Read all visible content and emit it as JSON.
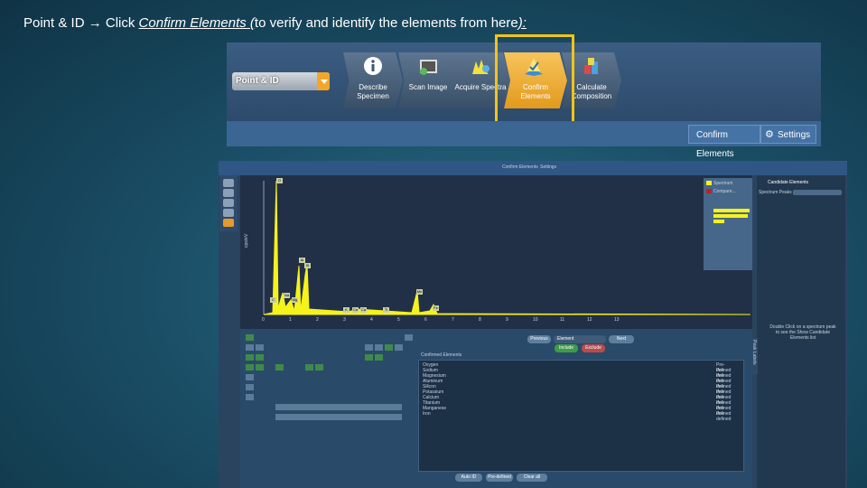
{
  "slide": {
    "title_prefix": "Point & ID ",
    "arrow": "→",
    "title_mid": " Click ",
    "title_link": "Confirm Elements (",
    "title_rest": "to verify and identify the elements from here",
    "title_end": "):"
  },
  "toolbar": {
    "dropdown": "Point & ID",
    "steps": [
      {
        "label": "Describe Specimen",
        "icon": "info-icon"
      },
      {
        "label": "Scan Image",
        "icon": "image-icon"
      },
      {
        "label": "Acquire Spectra",
        "icon": "spectrum-icon"
      },
      {
        "label": "Confirm Elements",
        "icon": "confirm-elements-icon"
      },
      {
        "label": "Calculate Composition",
        "icon": "composition-icon"
      }
    ],
    "ribbon_confirm": "Confirm Elements",
    "ribbon_settings": "Settings"
  },
  "app": {
    "header_confirm": "Confirm Elements",
    "header_settings": "Settings",
    "legend_series": [
      "Spectrum",
      "Compare..."
    ],
    "right_title": "Candidate Elements",
    "right_sub": "Spectrum Peaks",
    "right_hint": "Double Click on a spectrum peak to see the Show Candidate Elements list",
    "spectrum_labels": [
      "O",
      "Al",
      "Si",
      "C",
      "Mg",
      "Na",
      "K",
      "Ca",
      "Ca",
      "Ti",
      "Mn",
      "Fe"
    ],
    "x_ticks": [
      "0",
      "1",
      "2",
      "3",
      "4",
      "5",
      "6",
      "7",
      "8",
      "9",
      "10",
      "11",
      "12",
      "13"
    ],
    "nav": {
      "previous": "Previous",
      "next": "Next",
      "dropdown": "Element",
      "include": "Include",
      "exclude": "Exclude"
    },
    "list_title": "Confirmed Elements",
    "elements": [
      {
        "name": "Oxygen",
        "status": "Pre-defined"
      },
      {
        "name": "Sodium",
        "status": "Pre-defined"
      },
      {
        "name": "Magnesium",
        "status": "Pre-defined"
      },
      {
        "name": "Aluminum",
        "status": "Pre-defined"
      },
      {
        "name": "Silicon",
        "status": "Pre-defined"
      },
      {
        "name": "Potassium",
        "status": "Pre-defined"
      },
      {
        "name": "Calcium",
        "status": "Pre-defined"
      },
      {
        "name": "Titanium",
        "status": "Pre-defined"
      },
      {
        "name": "Manganese",
        "status": "Pre-defined"
      },
      {
        "name": "Iron",
        "status": "Pre-defined"
      }
    ],
    "bottom": {
      "auto_id": "Auto ID",
      "predefined": "Pre-defined",
      "clear_all": "Clear all"
    },
    "peak_labels": "Peak Labels"
  },
  "colors": {
    "accent": "#f0c419",
    "active_step": "#f2a72a",
    "spectrum": "#f5f21c"
  }
}
